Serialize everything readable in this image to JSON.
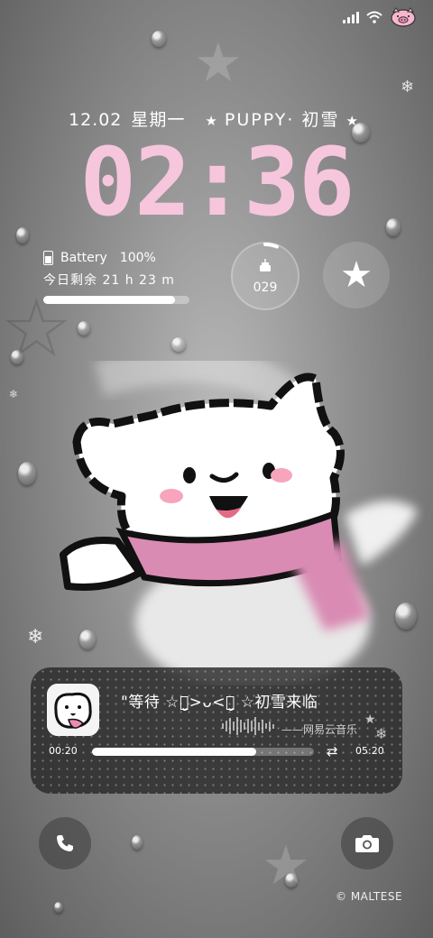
{
  "status_bar": {
    "signal_icon": "signal-icon",
    "wifi_icon": "wifi-icon",
    "avatar_icon": "pig-avatar-icon"
  },
  "header": {
    "date": "12.02",
    "weekday": "星期一",
    "title": "PUPPY· 初雪",
    "star_icon": "star-icon"
  },
  "clock": {
    "time": "02:36",
    "color": "#f6c6dd"
  },
  "battery": {
    "label": "Battery",
    "percent": "100%",
    "remaining": "今日剩余  21 h 23 m",
    "bar_fill": 0.9
  },
  "counter": {
    "value": "029",
    "icon": "cake-icon"
  },
  "music": {
    "song": "\"等待 ☆ꪔ̤̮>ᴗ<ꪔ̤̮ ☆初雪来临",
    "app_name": "——网易云音乐",
    "current_time": "00:20",
    "total_time": "05:20",
    "progress": 0.74,
    "loop_icon": "loop-icon"
  },
  "quick_actions": {
    "phone_icon": "phone-icon",
    "camera_icon": "camera-icon"
  },
  "watermark": "© MALTESE"
}
